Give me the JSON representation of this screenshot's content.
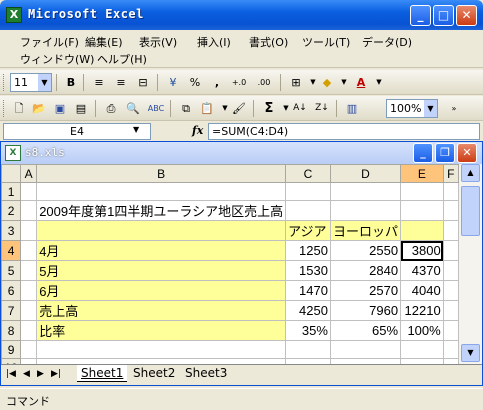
{
  "window": {
    "title": "Microsoft Excel",
    "min": "_",
    "max": "□",
    "close": "✕"
  },
  "menu": {
    "row1": [
      "ファイル(F)",
      "編集(E)",
      "表示(V)",
      "挿入(I)",
      "書式(O)",
      "ツール(T)",
      "データ(D)"
    ],
    "row2": [
      "ウィンドウ(W)",
      "ヘルプ(H)"
    ]
  },
  "format_toolbar": {
    "font_size": "11",
    "bold": "B",
    "percent": "%",
    "comma": ",",
    "dec_inc": "+.0",
    "dec_dec": ".00"
  },
  "standard_toolbar": {
    "sum": "Σ",
    "zoom": "100%"
  },
  "formula_bar": {
    "cell_ref": "E4",
    "fx": "fx",
    "formula": "=SUM(C4:D4)"
  },
  "document": {
    "name": "s8.xls"
  },
  "sheet": {
    "columns": [
      "A",
      "B",
      "C",
      "D",
      "E",
      "F"
    ],
    "rows": [
      {
        "n": "1",
        "cells": [
          "",
          "",
          "",
          "",
          "",
          ""
        ]
      },
      {
        "n": "2",
        "cells": [
          "",
          "2009年度第1四半期ユーラシア地区売上高",
          "",
          "",
          "",
          ""
        ]
      },
      {
        "n": "3",
        "cells": [
          "",
          "",
          "アジア",
          "ヨーロッパ",
          "",
          ""
        ]
      },
      {
        "n": "4",
        "cells": [
          "",
          "4月",
          "1250",
          "2550",
          "3800",
          ""
        ]
      },
      {
        "n": "5",
        "cells": [
          "",
          "5月",
          "1530",
          "2840",
          "4370",
          ""
        ]
      },
      {
        "n": "6",
        "cells": [
          "",
          "6月",
          "1470",
          "2570",
          "4040",
          ""
        ]
      },
      {
        "n": "7",
        "cells": [
          "",
          "売上高",
          "4250",
          "7960",
          "12210",
          ""
        ]
      },
      {
        "n": "8",
        "cells": [
          "",
          "比率",
          "35%",
          "65%",
          "100%",
          ""
        ]
      },
      {
        "n": "9",
        "cells": [
          "",
          "",
          "",
          "",
          "",
          ""
        ]
      },
      {
        "n": "10",
        "cells": [
          "",
          "",
          "",
          "",
          "",
          ""
        ]
      }
    ]
  },
  "tabs": [
    "Sheet1",
    "Sheet2",
    "Sheet3"
  ],
  "status": {
    "mode": "コマンド"
  },
  "colors": {
    "title_blue": "#0853d3",
    "highlight_yellow": "#ffff99",
    "active_header": "#ffc47c"
  }
}
